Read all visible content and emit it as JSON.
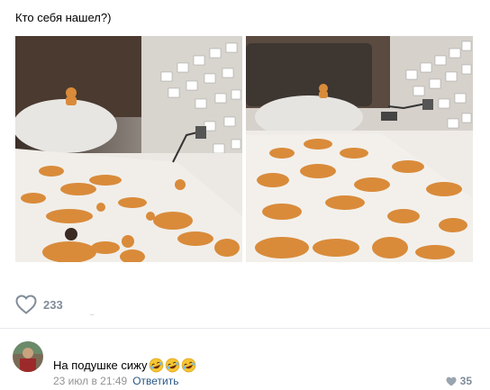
{
  "post": {
    "text": "Кто себя нашел?)",
    "likes": "233"
  },
  "comment": {
    "text": "На подушке сижу",
    "emoji": [
      "rofl-emoji",
      "rofl-emoji",
      "rofl-emoji"
    ],
    "date": "23 июл в 21:49",
    "reply_label": "Ответить",
    "likes": "35"
  },
  "colors": {
    "accent": "#2a5885",
    "muted": "#818c99",
    "divider": "#e7e8ec"
  }
}
